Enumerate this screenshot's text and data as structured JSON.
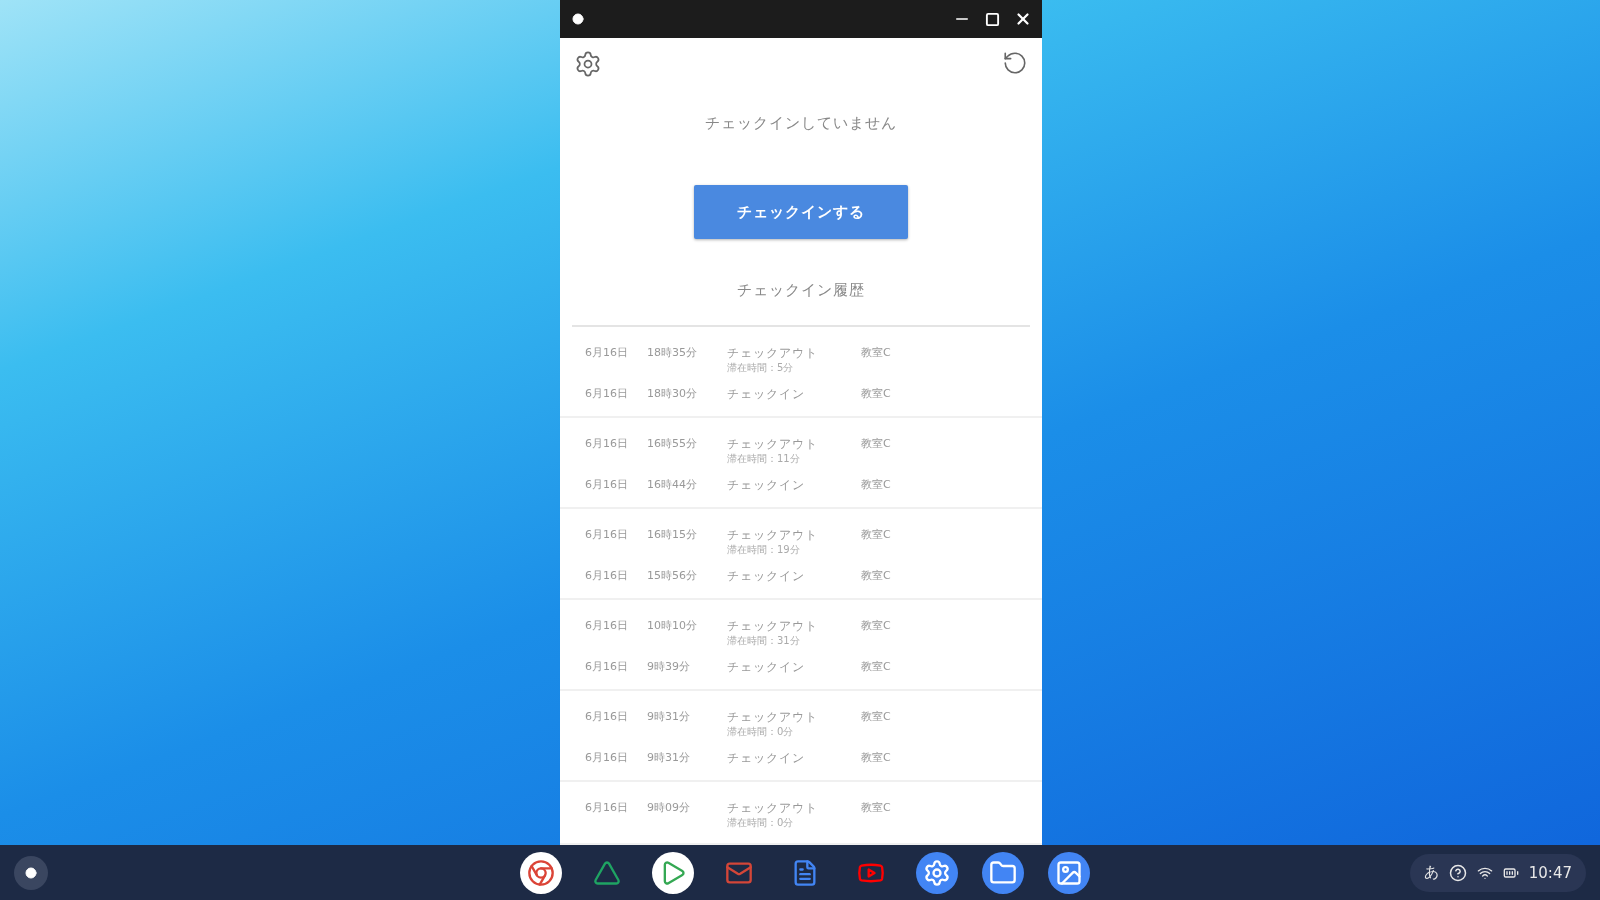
{
  "app": {
    "status": "チェックインしていません",
    "checkin_button": "チェックインする",
    "history_title": "チェックイン履歴"
  },
  "history": [
    {
      "entries": [
        {
          "date": "6月16日",
          "time": "18時35分",
          "action": "チェックアウト",
          "stay": "滞在時間：5分",
          "place": "教室C"
        },
        {
          "date": "6月16日",
          "time": "18時30分",
          "action": "チェックイン",
          "place": "教室C"
        }
      ]
    },
    {
      "entries": [
        {
          "date": "6月16日",
          "time": "16時55分",
          "action": "チェックアウト",
          "stay": "滞在時間：11分",
          "place": "教室C"
        },
        {
          "date": "6月16日",
          "time": "16時44分",
          "action": "チェックイン",
          "place": "教室C"
        }
      ]
    },
    {
      "entries": [
        {
          "date": "6月16日",
          "time": "16時15分",
          "action": "チェックアウト",
          "stay": "滞在時間：19分",
          "place": "教室C"
        },
        {
          "date": "6月16日",
          "time": "15時56分",
          "action": "チェックイン",
          "place": "教室C"
        }
      ]
    },
    {
      "entries": [
        {
          "date": "6月16日",
          "time": "10時10分",
          "action": "チェックアウト",
          "stay": "滞在時間：31分",
          "place": "教室C"
        },
        {
          "date": "6月16日",
          "time": "9時39分",
          "action": "チェックイン",
          "place": "教室C"
        }
      ]
    },
    {
      "entries": [
        {
          "date": "6月16日",
          "time": "9時31分",
          "action": "チェックアウト",
          "stay": "滞在時間：0分",
          "place": "教室C"
        },
        {
          "date": "6月16日",
          "time": "9時31分",
          "action": "チェックイン",
          "place": "教室C"
        }
      ]
    },
    {
      "entries": [
        {
          "date": "6月16日",
          "time": "9時09分",
          "action": "チェックアウト",
          "stay": "滞在時間：0分",
          "place": "教室C"
        }
      ]
    }
  ],
  "shelf": {
    "tray": {
      "ime": "あ",
      "time": "10:47"
    }
  }
}
